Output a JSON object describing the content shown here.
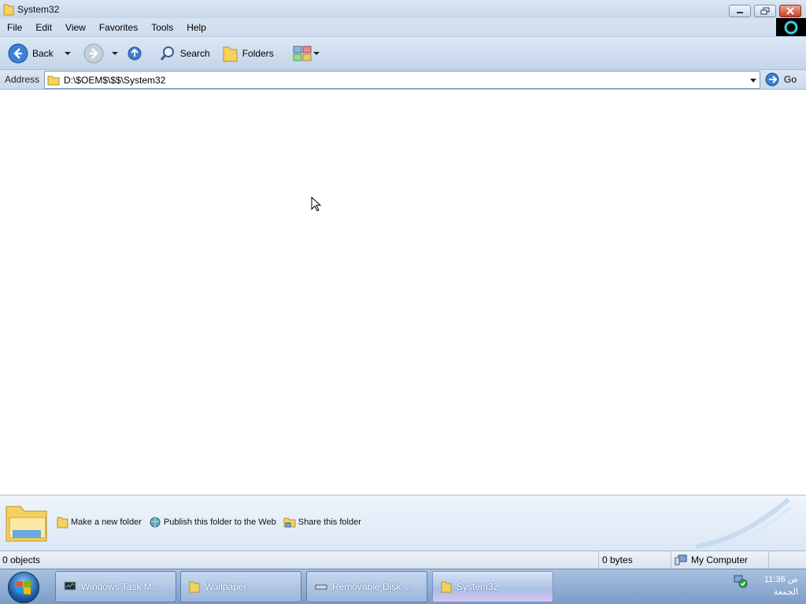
{
  "window": {
    "title": "System32"
  },
  "menu": {
    "items": [
      "File",
      "Edit",
      "View",
      "Favorites",
      "Tools",
      "Help"
    ]
  },
  "toolbar": {
    "back_label": "Back",
    "search_label": "Search",
    "folders_label": "Folders"
  },
  "address": {
    "label": "Address",
    "value": "D:\\$OEM$\\$$\\System32",
    "go_label": "Go"
  },
  "tasks": {
    "make_folder": "Make a new folder",
    "publish": "Publish this folder to the Web",
    "share": "Share this folder"
  },
  "status": {
    "objects": "0 objects",
    "size": "0 bytes",
    "location": "My Computer"
  },
  "taskbar": {
    "items": [
      {
        "label": "Windows Task M..."
      },
      {
        "label": "Wallpaper"
      },
      {
        "label": "Removable Disk ..."
      },
      {
        "label": "System32"
      }
    ],
    "clock_time": "11:36 ص",
    "clock_day": "الجمعة"
  },
  "colors": {
    "folder": "#f4d25f",
    "accent": "#2d6bc4",
    "close": "#c6402a"
  }
}
